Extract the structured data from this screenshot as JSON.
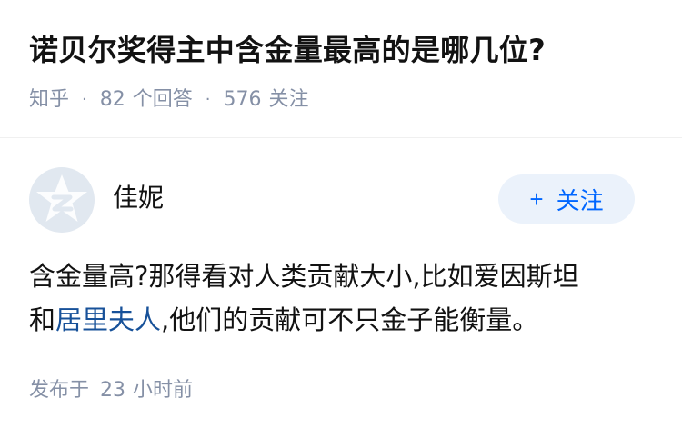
{
  "question": {
    "title": "诺贝尔奖得主中含金量最高的是哪几位?",
    "source": "知乎",
    "answers_count": "82",
    "answers_label": "个回答",
    "followers_count": "576",
    "followers_label": "关注"
  },
  "answer": {
    "author_name": "佳妮",
    "avatar_icon": "default-avatar-icon",
    "follow_button": {
      "plus": "+",
      "label": "关注"
    },
    "content": {
      "line1": "含金量高?那得看对人类贡献大小,比如爱因斯坦",
      "line2_start": "和",
      "link_text": "居里夫人",
      "line2_end": ",他们的贡献可不只金子能衡量。"
    },
    "posted_label": "发布于",
    "posted_number": "23",
    "posted_unit": "小时前"
  },
  "colors": {
    "accent": "#0066ff",
    "link": "#175199",
    "meta_gray": "#8590a6",
    "follow_bg": "#ebf2fb",
    "avatar_bg": "#e1e8f0"
  }
}
